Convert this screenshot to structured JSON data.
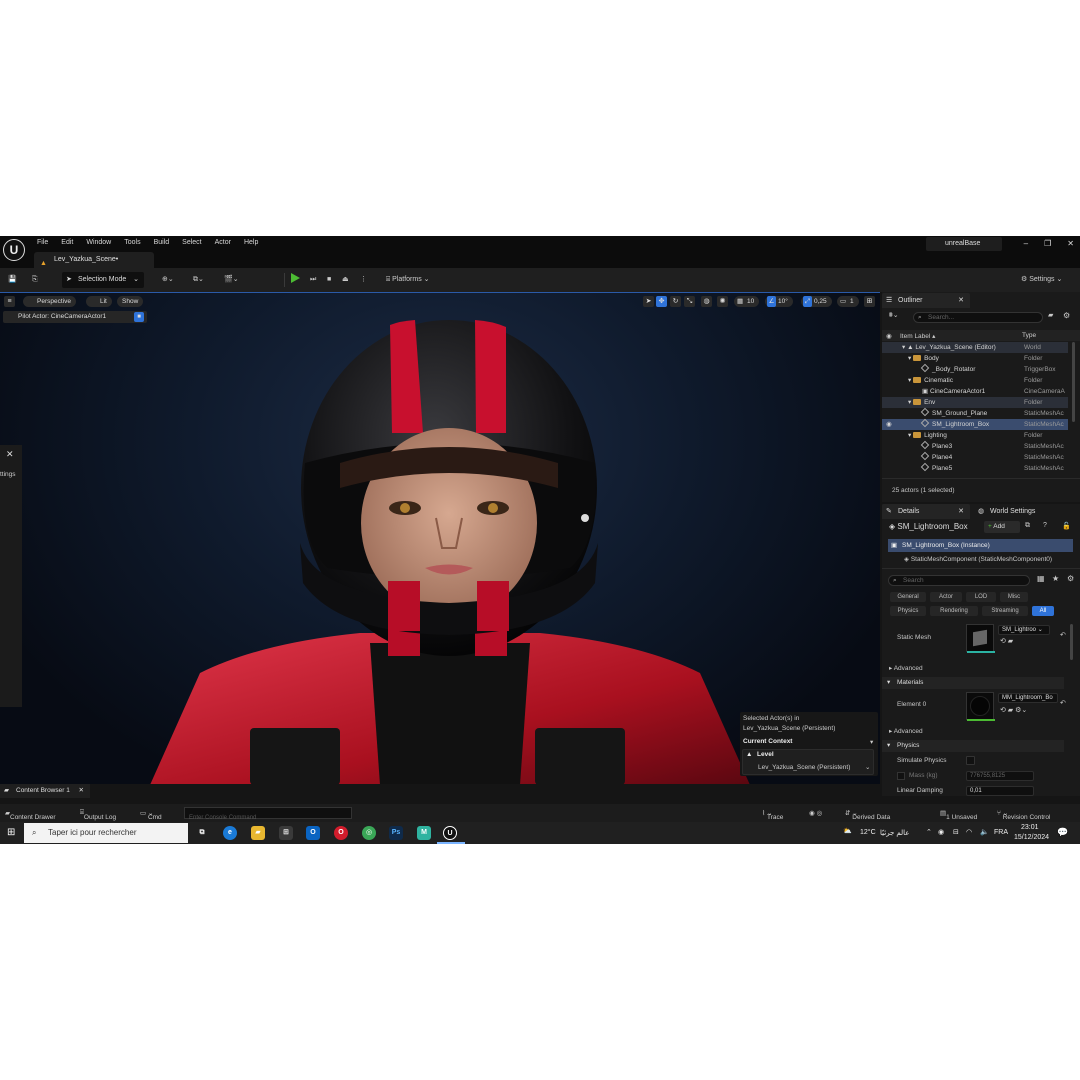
{
  "menu": {
    "items": [
      "File",
      "Edit",
      "Window",
      "Tools",
      "Build",
      "Select",
      "Actor",
      "Help"
    ],
    "project": "unrealBase"
  },
  "tab": {
    "scene": "Lev_Yazkua_Scene•"
  },
  "toolbar": {
    "selection_mode": "Selection Mode",
    "platforms": "Platforms",
    "settings": "Settings"
  },
  "viewport": {
    "perspective": "Perspective",
    "lit": "Lit",
    "show": "Show",
    "pilot": "Pilot Actor: CineCameraActor1",
    "grid_snap": "10",
    "rot_snap": "10°",
    "scale_snap": "0,25",
    "cam_speed": "1",
    "left_label": "ttings"
  },
  "context": {
    "selected_line1": "Selected Actor(s) in",
    "selected_line2": "Lev_Yazkua_Scene (Persistent)",
    "current_context": "Current Context",
    "level_label": "Level",
    "level_value": "Lev_Yazkua_Scene (Persistent)"
  },
  "outliner": {
    "tab": "Outliner",
    "search_placeholder": "Search...",
    "col_label": "Item Label ▴",
    "col_type": "Type",
    "rows": [
      {
        "label": "Lev_Yazkua_Scene (Editor)",
        "type": "World"
      },
      {
        "label": "Body",
        "type": "Folder"
      },
      {
        "label": "_Body_Rotator",
        "type": "TriggerBox"
      },
      {
        "label": "Cinematic",
        "type": "Folder"
      },
      {
        "label": "CineCameraActor1",
        "type": "CineCameraA"
      },
      {
        "label": "Env",
        "type": "Folder"
      },
      {
        "label": "SM_Ground_Plane",
        "type": "StaticMeshAc"
      },
      {
        "label": "SM_Lightroom_Box",
        "type": "StaticMeshAc"
      },
      {
        "label": "Lighting",
        "type": "Folder"
      },
      {
        "label": "Plane3",
        "type": "StaticMeshAc"
      },
      {
        "label": "Plane4",
        "type": "StaticMeshAc"
      },
      {
        "label": "Plane5",
        "type": "StaticMeshAc"
      }
    ],
    "count": "25 actors (1 selected)"
  },
  "details": {
    "tab": "Details",
    "world_tab": "World Settings",
    "actor_name": "SM_Lightroom_Box",
    "add": "Add",
    "instance": "SM_Lightroom_Box (Instance)",
    "component": "StaticMeshComponent (StaticMeshComponent0)",
    "search_placeholder": "Search",
    "categories": [
      "General",
      "Actor",
      "LOD",
      "Misc",
      "Physics",
      "Rendering",
      "Streaming",
      "All"
    ],
    "static_mesh_label": "Static Mesh",
    "static_mesh_value": "SM_Lightroo",
    "advanced": "Advanced",
    "materials": "Materials",
    "element0": "Element 0",
    "material_value": "MM_Lightroom_Bo",
    "physics": "Physics",
    "simulate_physics": "Simulate Physics",
    "mass": "Mass (kg)",
    "mass_value": "776755,8125",
    "linear_damping": "Linear Damping",
    "linear_damping_value": "0,01"
  },
  "bottom": {
    "content_browser": "Content Browser 1",
    "content_drawer": "Content Drawer",
    "output_log": "Output Log",
    "cmd": "Cmd",
    "console_placeholder": "Enter Console Command",
    "trace": "Trace",
    "derived": "Derived Data",
    "unsaved": "1 Unsaved",
    "revision": "Revision Control"
  },
  "taskbar": {
    "search": "Taper ici pour rechercher",
    "temp": "12°C",
    "weather": "عالم جرثيًا",
    "lang": "FRA",
    "time": "23:01",
    "date": "15/12/2024"
  },
  "colors": {
    "accent": "#2f73d9",
    "play": "#4cbb33",
    "folder": "#c9953a",
    "helmet_stripe": "#c8102e"
  }
}
